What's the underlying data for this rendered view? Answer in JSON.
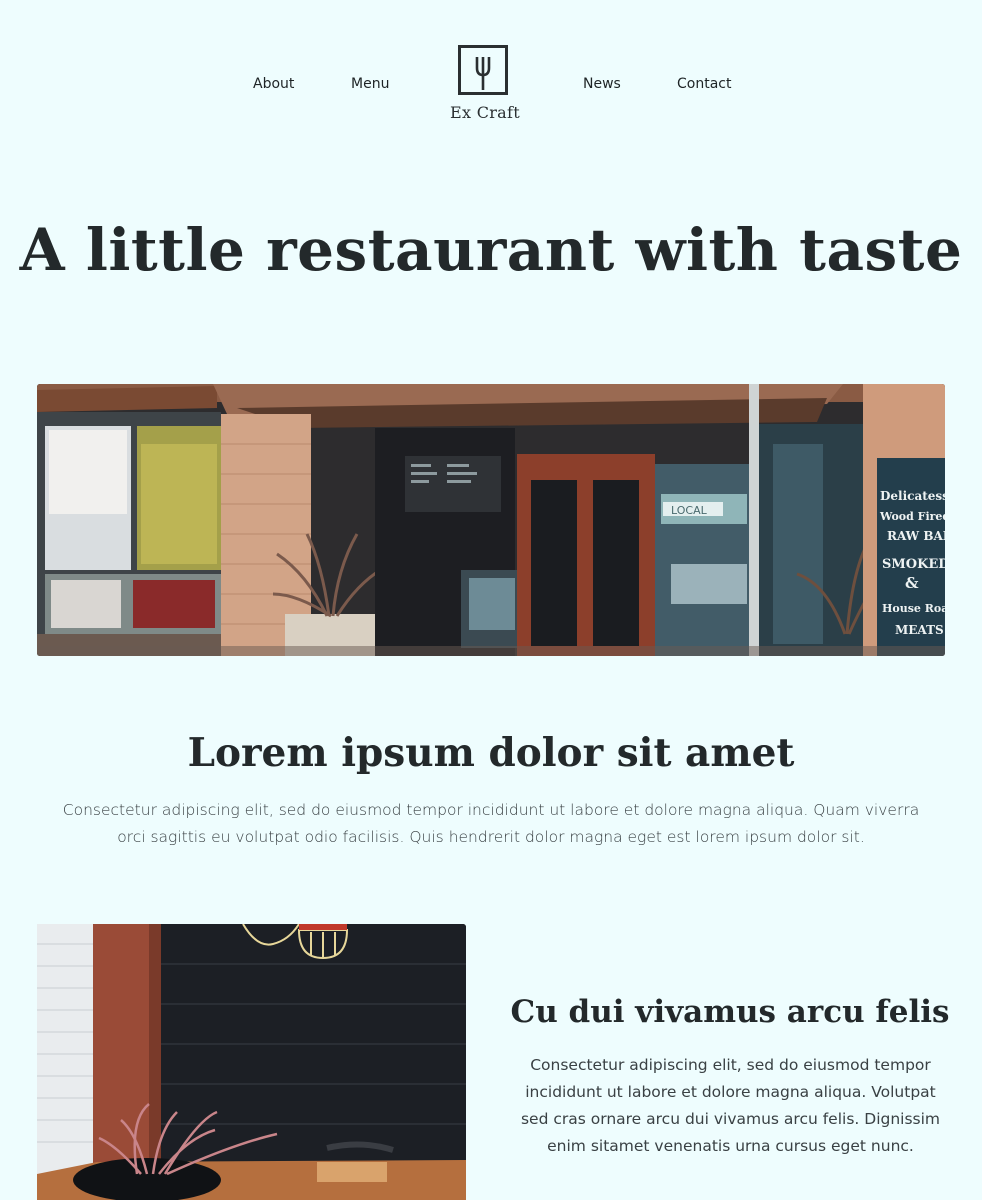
{
  "nav": {
    "left": [
      {
        "label": "About"
      },
      {
        "label": "Menu"
      }
    ],
    "right": [
      {
        "label": "News"
      },
      {
        "label": "Contact"
      }
    ],
    "logo": {
      "icon": "fork-icon",
      "text": "Ex Craft"
    }
  },
  "hero": {
    "title": "A little restaurant with taste"
  },
  "storefront_image": {
    "icon": "storefront-photo",
    "signs": {
      "local": "LOCAL",
      "board_lines": [
        "Delicatessen",
        "Wood Fired Pizza",
        "RAW BAR",
        "SMOKED FISH",
        "&",
        "House Roast",
        "MEATS"
      ]
    }
  },
  "section1": {
    "title": "Lorem ipsum dolor sit amet",
    "body": "Consectetur adipiscing elit, sed do eiusmod tempor incididunt ut labore et dolore magna aliqua. Quam viverra orci sagittis eu volutpat odio facilisis. Quis hendrerit dolor magna eget est lorem ipsum dolor sit."
  },
  "section2": {
    "image_icon": "restaurant-interior-photo",
    "title": "Cu dui vivamus arcu felis",
    "body": "Consectetur adipiscing elit, sed do eiusmod tempor incididunt ut labore et dolore magna aliqua. Volutpat sed cras ornare arcu dui vivamus arcu felis. Dignissim enim sitamet venenatis urna cursus eget nunc."
  },
  "colors": {
    "background": "#eefdfe",
    "text": "#23292b",
    "body_text": "#3a4144"
  }
}
